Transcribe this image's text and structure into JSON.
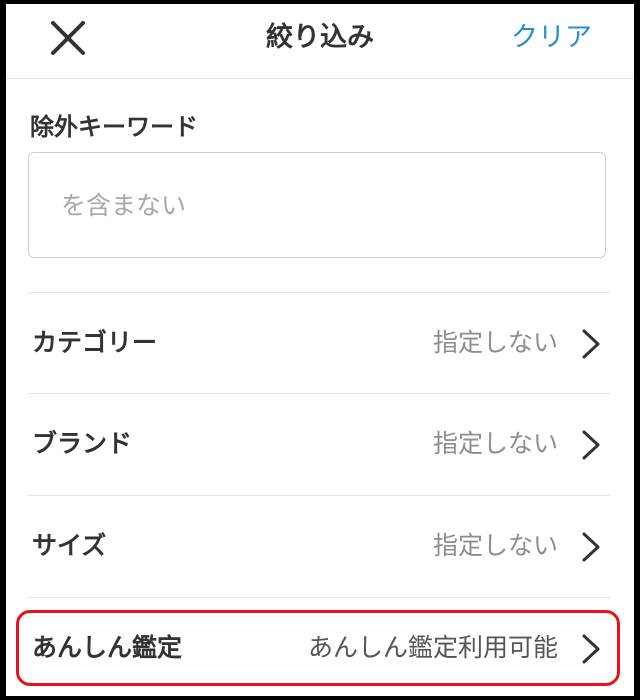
{
  "header": {
    "title": "絞り込み",
    "clear_label": "クリア",
    "close_icon": "close-icon"
  },
  "exclude_keyword": {
    "label": "除外キーワード",
    "placeholder": "を含まない",
    "value": ""
  },
  "filters": [
    {
      "label": "カテゴリー",
      "value": "指定しない"
    },
    {
      "label": "ブランド",
      "value": "指定しない"
    },
    {
      "label": "サイズ",
      "value": "指定しない"
    },
    {
      "label": "あんしん鑑定",
      "value": "あんしん鑑定利用可能"
    }
  ],
  "colors": {
    "accent": "#2a8fd0",
    "highlight": "#e8101a",
    "text": "#333333",
    "muted": "#8e8e8e"
  }
}
